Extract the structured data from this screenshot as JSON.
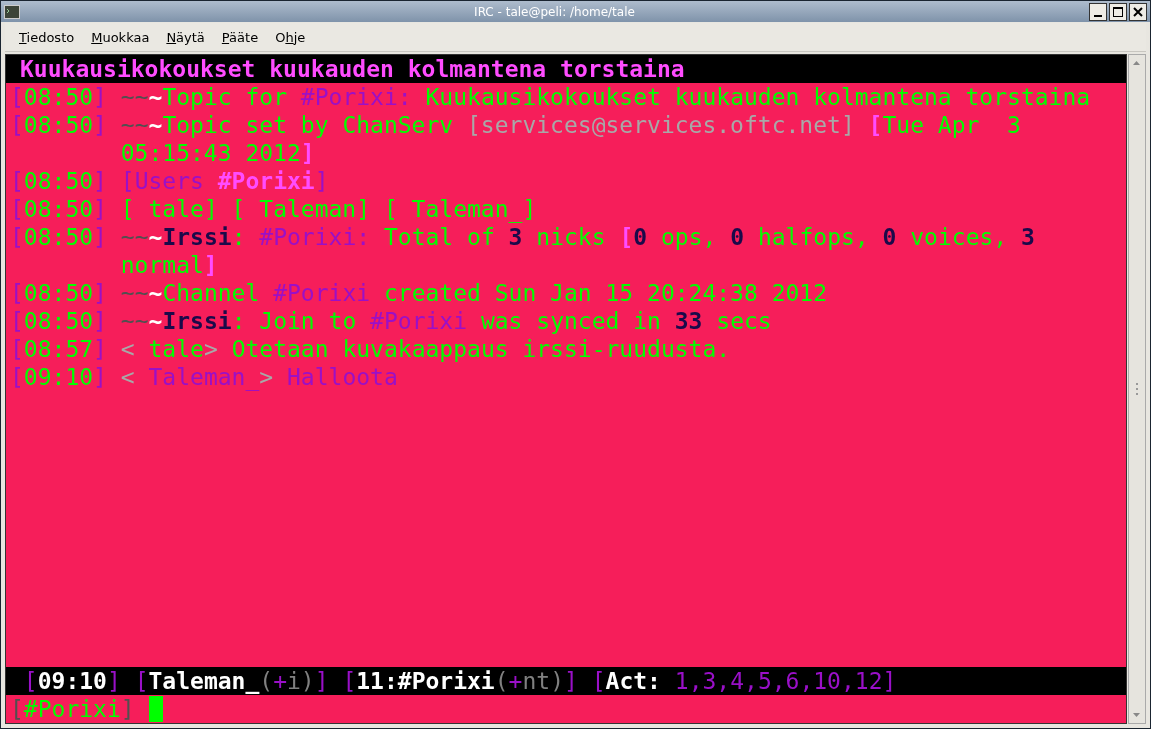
{
  "window": {
    "title": "IRC - tale@peli: /home/tale"
  },
  "menu": [
    {
      "key": "T",
      "after": "iedosto"
    },
    {
      "key": "M",
      "after": "uokkaa"
    },
    {
      "key": "N",
      "after": "äytä"
    },
    {
      "key": "P",
      "after": "ääte"
    },
    {
      "before": "O",
      "key": "h",
      "after": "je"
    }
  ],
  "topic": {
    "text": "Kuukausikokoukset kuukauden kolmantena torstaina"
  },
  "lines": [
    {
      "continuation": false,
      "segments": [
        {
          "text": "[",
          "color": "#9a10c8",
          "bold": false
        },
        {
          "text": "08:50",
          "color": "#00ff00",
          "bold": false
        },
        {
          "text": "] ",
          "color": "#9a10c8",
          "bold": false
        },
        {
          "text": "~~",
          "color": "#505050",
          "bold": false
        },
        {
          "text": "~",
          "color": "#ffffff",
          "bold": true
        },
        {
          "text": "Topic for ",
          "color": "#00ff00",
          "bold": false
        },
        {
          "text": "#Porixi:",
          "color": "#9a10c8",
          "bold": false
        },
        {
          "text": " Kuukausikokoukset kuukauden kolmantena torstaina",
          "color": "#00ff00",
          "bold": false
        }
      ]
    },
    {
      "continuation": false,
      "segments": [
        {
          "text": "[",
          "color": "#9a10c8",
          "bold": false
        },
        {
          "text": "08:50",
          "color": "#00ff00",
          "bold": false
        },
        {
          "text": "] ",
          "color": "#9a10c8",
          "bold": false
        },
        {
          "text": "~~",
          "color": "#505050",
          "bold": false
        },
        {
          "text": "~",
          "color": "#ffffff",
          "bold": true
        },
        {
          "text": "Topic set by ChanServ ",
          "color": "#00ff00",
          "bold": false
        },
        {
          "text": "[services@services.oftc.net] ",
          "color": "#a8a8a8",
          "bold": false
        },
        {
          "text": "[",
          "color": "#ff4cff",
          "bold": true
        },
        {
          "text": "Tue Apr  3",
          "color": "#00ff00",
          "bold": false
        }
      ]
    },
    {
      "continuation": true,
      "segments": [
        {
          "text": "05:15:43 2012",
          "color": "#00ff00",
          "bold": false
        },
        {
          "text": "]",
          "color": "#ff4cff",
          "bold": true
        }
      ]
    },
    {
      "continuation": false,
      "segments": [
        {
          "text": "[",
          "color": "#9a10c8",
          "bold": false
        },
        {
          "text": "08:50",
          "color": "#00ff00",
          "bold": false
        },
        {
          "text": "] ",
          "color": "#9a10c8",
          "bold": false
        },
        {
          "text": "[Users ",
          "color": "#9a10c8",
          "bold": false
        },
        {
          "text": "#Porixi",
          "color": "#ff4cff",
          "bold": true
        },
        {
          "text": "]",
          "color": "#9a10c8",
          "bold": false
        }
      ]
    },
    {
      "continuation": false,
      "segments": [
        {
          "text": "[",
          "color": "#9a10c8",
          "bold": false
        },
        {
          "text": "08:50",
          "color": "#00ff00",
          "bold": false
        },
        {
          "text": "] ",
          "color": "#9a10c8",
          "bold": false
        },
        {
          "text": "[ tale] [ Taleman] [ Taleman_]",
          "color": "#00ff00",
          "bold": false
        }
      ]
    },
    {
      "continuation": false,
      "segments": [
        {
          "text": "[",
          "color": "#9a10c8",
          "bold": false
        },
        {
          "text": "08:50",
          "color": "#00ff00",
          "bold": false
        },
        {
          "text": "] ",
          "color": "#9a10c8",
          "bold": false
        },
        {
          "text": "~~",
          "color": "#505050",
          "bold": false
        },
        {
          "text": "~",
          "color": "#ffffff",
          "bold": true
        },
        {
          "text": "Irssi",
          "color": "#1a0a4a",
          "bold": true
        },
        {
          "text": ": ",
          "color": "#00ff00",
          "bold": false
        },
        {
          "text": "#Porixi: ",
          "color": "#9a10c8",
          "bold": false
        },
        {
          "text": "Total of ",
          "color": "#00ff00",
          "bold": false
        },
        {
          "text": "3",
          "color": "#1a0a4a",
          "bold": true
        },
        {
          "text": " nicks ",
          "color": "#00ff00",
          "bold": false
        },
        {
          "text": "[",
          "color": "#ff4cff",
          "bold": true
        },
        {
          "text": "0",
          "color": "#1a0a4a",
          "bold": true
        },
        {
          "text": " ops, ",
          "color": "#00ff00",
          "bold": false
        },
        {
          "text": "0",
          "color": "#1a0a4a",
          "bold": true
        },
        {
          "text": " halfops, ",
          "color": "#00ff00",
          "bold": false
        },
        {
          "text": "0",
          "color": "#1a0a4a",
          "bold": true
        },
        {
          "text": " voices, ",
          "color": "#00ff00",
          "bold": false
        },
        {
          "text": "3",
          "color": "#1a0a4a",
          "bold": true
        }
      ]
    },
    {
      "continuation": true,
      "segments": [
        {
          "text": "normal",
          "color": "#00ff00",
          "bold": false
        },
        {
          "text": "]",
          "color": "#ff4cff",
          "bold": true
        }
      ]
    },
    {
      "continuation": false,
      "segments": [
        {
          "text": "[",
          "color": "#9a10c8",
          "bold": false
        },
        {
          "text": "08:50",
          "color": "#00ff00",
          "bold": false
        },
        {
          "text": "] ",
          "color": "#9a10c8",
          "bold": false
        },
        {
          "text": "~~",
          "color": "#505050",
          "bold": false
        },
        {
          "text": "~",
          "color": "#ffffff",
          "bold": true
        },
        {
          "text": "Channel ",
          "color": "#00ff00",
          "bold": false
        },
        {
          "text": "#Porixi",
          "color": "#9a10c8",
          "bold": false
        },
        {
          "text": " created Sun Jan 15 20:24:38 2012",
          "color": "#00ff00",
          "bold": false
        }
      ]
    },
    {
      "continuation": false,
      "segments": [
        {
          "text": "[",
          "color": "#9a10c8",
          "bold": false
        },
        {
          "text": "08:50",
          "color": "#00ff00",
          "bold": false
        },
        {
          "text": "] ",
          "color": "#9a10c8",
          "bold": false
        },
        {
          "text": "~~",
          "color": "#505050",
          "bold": false
        },
        {
          "text": "~",
          "color": "#ffffff",
          "bold": true
        },
        {
          "text": "Irssi",
          "color": "#1a0a4a",
          "bold": true
        },
        {
          "text": ": Join to ",
          "color": "#00ff00",
          "bold": false
        },
        {
          "text": "#Porixi",
          "color": "#9a10c8",
          "bold": false
        },
        {
          "text": " was synced in ",
          "color": "#00ff00",
          "bold": false
        },
        {
          "text": "33",
          "color": "#1a0a4a",
          "bold": true
        },
        {
          "text": " secs",
          "color": "#00ff00",
          "bold": false
        }
      ]
    },
    {
      "continuation": false,
      "segments": [
        {
          "text": "[",
          "color": "#9a10c8",
          "bold": false
        },
        {
          "text": "08:57",
          "color": "#00ff00",
          "bold": false
        },
        {
          "text": "] ",
          "color": "#9a10c8",
          "bold": false
        },
        {
          "text": "<",
          "color": "#a8a8a8",
          "bold": false
        },
        {
          "text": " tale",
          "color": "#00ff00",
          "bold": false
        },
        {
          "text": ">",
          "color": "#a8a8a8",
          "bold": false
        },
        {
          "text": " Otetaan kuvakaappaus irssi-ruudusta.",
          "color": "#00ff00",
          "bold": false
        }
      ]
    },
    {
      "continuation": false,
      "segments": [
        {
          "text": "[",
          "color": "#9a10c8",
          "bold": false
        },
        {
          "text": "09:10",
          "color": "#00ff00",
          "bold": false
        },
        {
          "text": "] ",
          "color": "#9a10c8",
          "bold": false
        },
        {
          "text": "< ",
          "color": "#a8a8a8",
          "bold": false
        },
        {
          "text": "Taleman_",
          "color": "#9a10c8",
          "bold": false
        },
        {
          "text": ">",
          "color": "#a8a8a8",
          "bold": false
        },
        {
          "text": " Halloota",
          "color": "#9a10c8",
          "bold": false
        }
      ]
    }
  ],
  "status_bar": [
    {
      "text": " [",
      "kind": "bracket"
    },
    {
      "text": "09:10",
      "kind": "item"
    },
    {
      "text": "] [",
      "kind": "bracket"
    },
    {
      "text": "Taleman_",
      "kind": "item"
    },
    {
      "text": "(",
      "kind": "mode"
    },
    {
      "text": "+",
      "kind": "bracket"
    },
    {
      "text": "i)",
      "kind": "mode"
    },
    {
      "text": "] [",
      "kind": "bracket"
    },
    {
      "text": "11:#Porixi",
      "kind": "item"
    },
    {
      "text": "(",
      "kind": "mode"
    },
    {
      "text": "+",
      "kind": "bracket"
    },
    {
      "text": "nt)",
      "kind": "mode"
    },
    {
      "text": "] [",
      "kind": "bracket"
    },
    {
      "text": "Act: ",
      "kind": "item"
    },
    {
      "text": "1,3,4,5,6,10,12",
      "kind": "bracket"
    },
    {
      "text": "]",
      "kind": "bracket"
    }
  ],
  "prompt": [
    {
      "text": "[",
      "kind": "bracket"
    },
    {
      "text": "#Porixi",
      "kind": "channel"
    },
    {
      "text": "]",
      "kind": "bracket"
    }
  ]
}
